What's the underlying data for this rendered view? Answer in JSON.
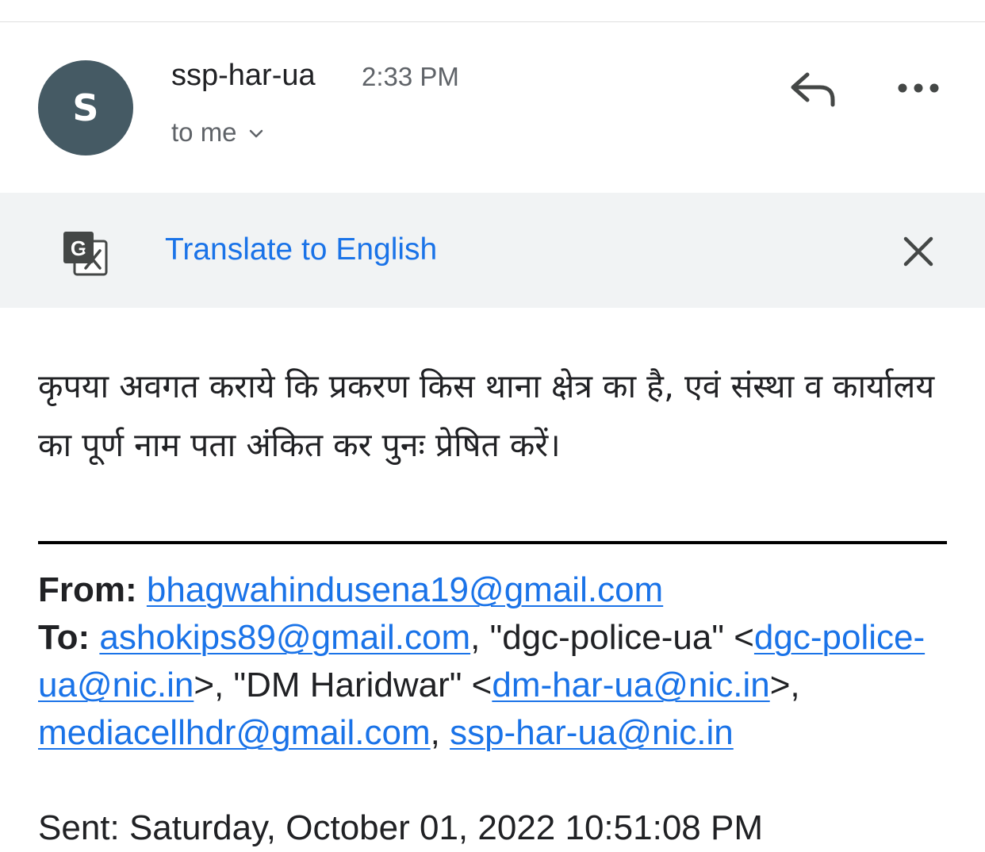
{
  "header": {
    "avatar_letter": "S",
    "sender": "ssp-har-ua",
    "time": "2:33 PM",
    "recipient": "to me",
    "avatar_color": "#455a64"
  },
  "translate": {
    "link_label": "Translate to English",
    "icon": "google-translate-icon",
    "accent": "#1a73e8"
  },
  "body": {
    "message": "कृपया अवगत कराये कि प्रकरण किस थाना क्षेत्र का है, एवं संस्था व कार्यालय का पूर्ण नाम पता अंकित कर पुनः प्रेषित करें।"
  },
  "forwarded": {
    "from_label": "From:",
    "from_email": "bhagwahindusena19@gmail.com",
    "to_label": "To:",
    "to_email1": "ashokips89@gmail.com",
    "sep1": ", ",
    "to_name2": "\"dgc-police-ua\" <",
    "to_email2": "dgc-police-ua@nic.in",
    "sep2": ">, ",
    "to_name3": "\"DM Haridwar\" <",
    "to_email3": "dm-har-ua@nic.in",
    "sep3": ">, ",
    "to_email4": "mediacellhdr@gmail.com",
    "sep4": ", ",
    "to_email5": "ssp-har-ua@nic.in",
    "sent_line": "Sent: Saturday, October 01, 2022 10:51:08 PM"
  }
}
